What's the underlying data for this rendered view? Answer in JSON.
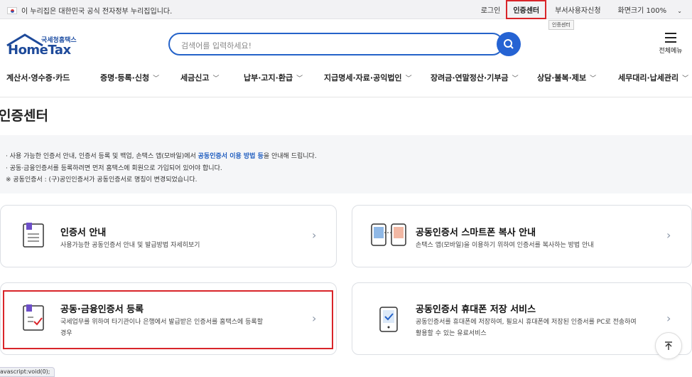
{
  "topbar": {
    "gov_notice": "이 누리집은 대한민국 공식 전자정부 누리집입니다.",
    "links": {
      "login": "로그인",
      "cert_center": "인증센터",
      "dept_user": "부서사용자신청",
      "zoom_label": "화면크기 100%"
    },
    "tooltip": "인증센터"
  },
  "header": {
    "logo_sub": "국세청홈택스",
    "logo_main": "HomeTax",
    "search_placeholder": "검색어를 입력하세요!",
    "all_menu": "전체메뉴"
  },
  "nav": [
    "계산서·영수증·카드",
    "증명·등록·신청",
    "세금신고",
    "납부·고지·환급",
    "지급명세·자료·공익법인",
    "장려금·연말정산·기부금",
    "상담·불복·제보",
    "세무대리·납세관리"
  ],
  "page": {
    "title": "인증센터",
    "info_line1_a": "사용 가능한 인증서 안내, 인증서 등록 및 백업, 손택스 앱(모바일)에서 ",
    "info_line1_hl": "공동인증서 이용 방법 등",
    "info_line1_b": "을 안내해 드립니다.",
    "info_line2": "공동·금융인증서를 등록하려면 먼저 홈택스에 회원으로 가입되어 있어야 합니다.",
    "info_line3": "※ 공동인증서 : (구)공인인증서가 공동인증서로 명칭이 변경되었습니다."
  },
  "cards": [
    {
      "title": "인증서 안내",
      "desc": "사용가능한 공동인증서 안내 및 발급방법 자세히보기"
    },
    {
      "title": "공동인증서 스마트폰 복사 안내",
      "desc": "손택스 앱(모바일)을 이용하기 위하여 인증서를 복사하는 방법 안내"
    },
    {
      "title": "공동·금융인증서 등록",
      "desc": "국세업무를 위하여 타기관이나 은행에서 발급받은 인증서를 홈택스에 등록할 경우"
    },
    {
      "title": "공동인증서 휴대폰 저장 서비스",
      "desc": "공동인증서를 휴대폰에 저장하여, 필요시 휴대폰에 저장된 인증서를 PC로 전송하여 활용할 수 있는 유료서비스"
    }
  ],
  "status_bar": "avascript:void(0);",
  "colors": {
    "accent": "#2563c9",
    "highlight": "#d9252a"
  }
}
